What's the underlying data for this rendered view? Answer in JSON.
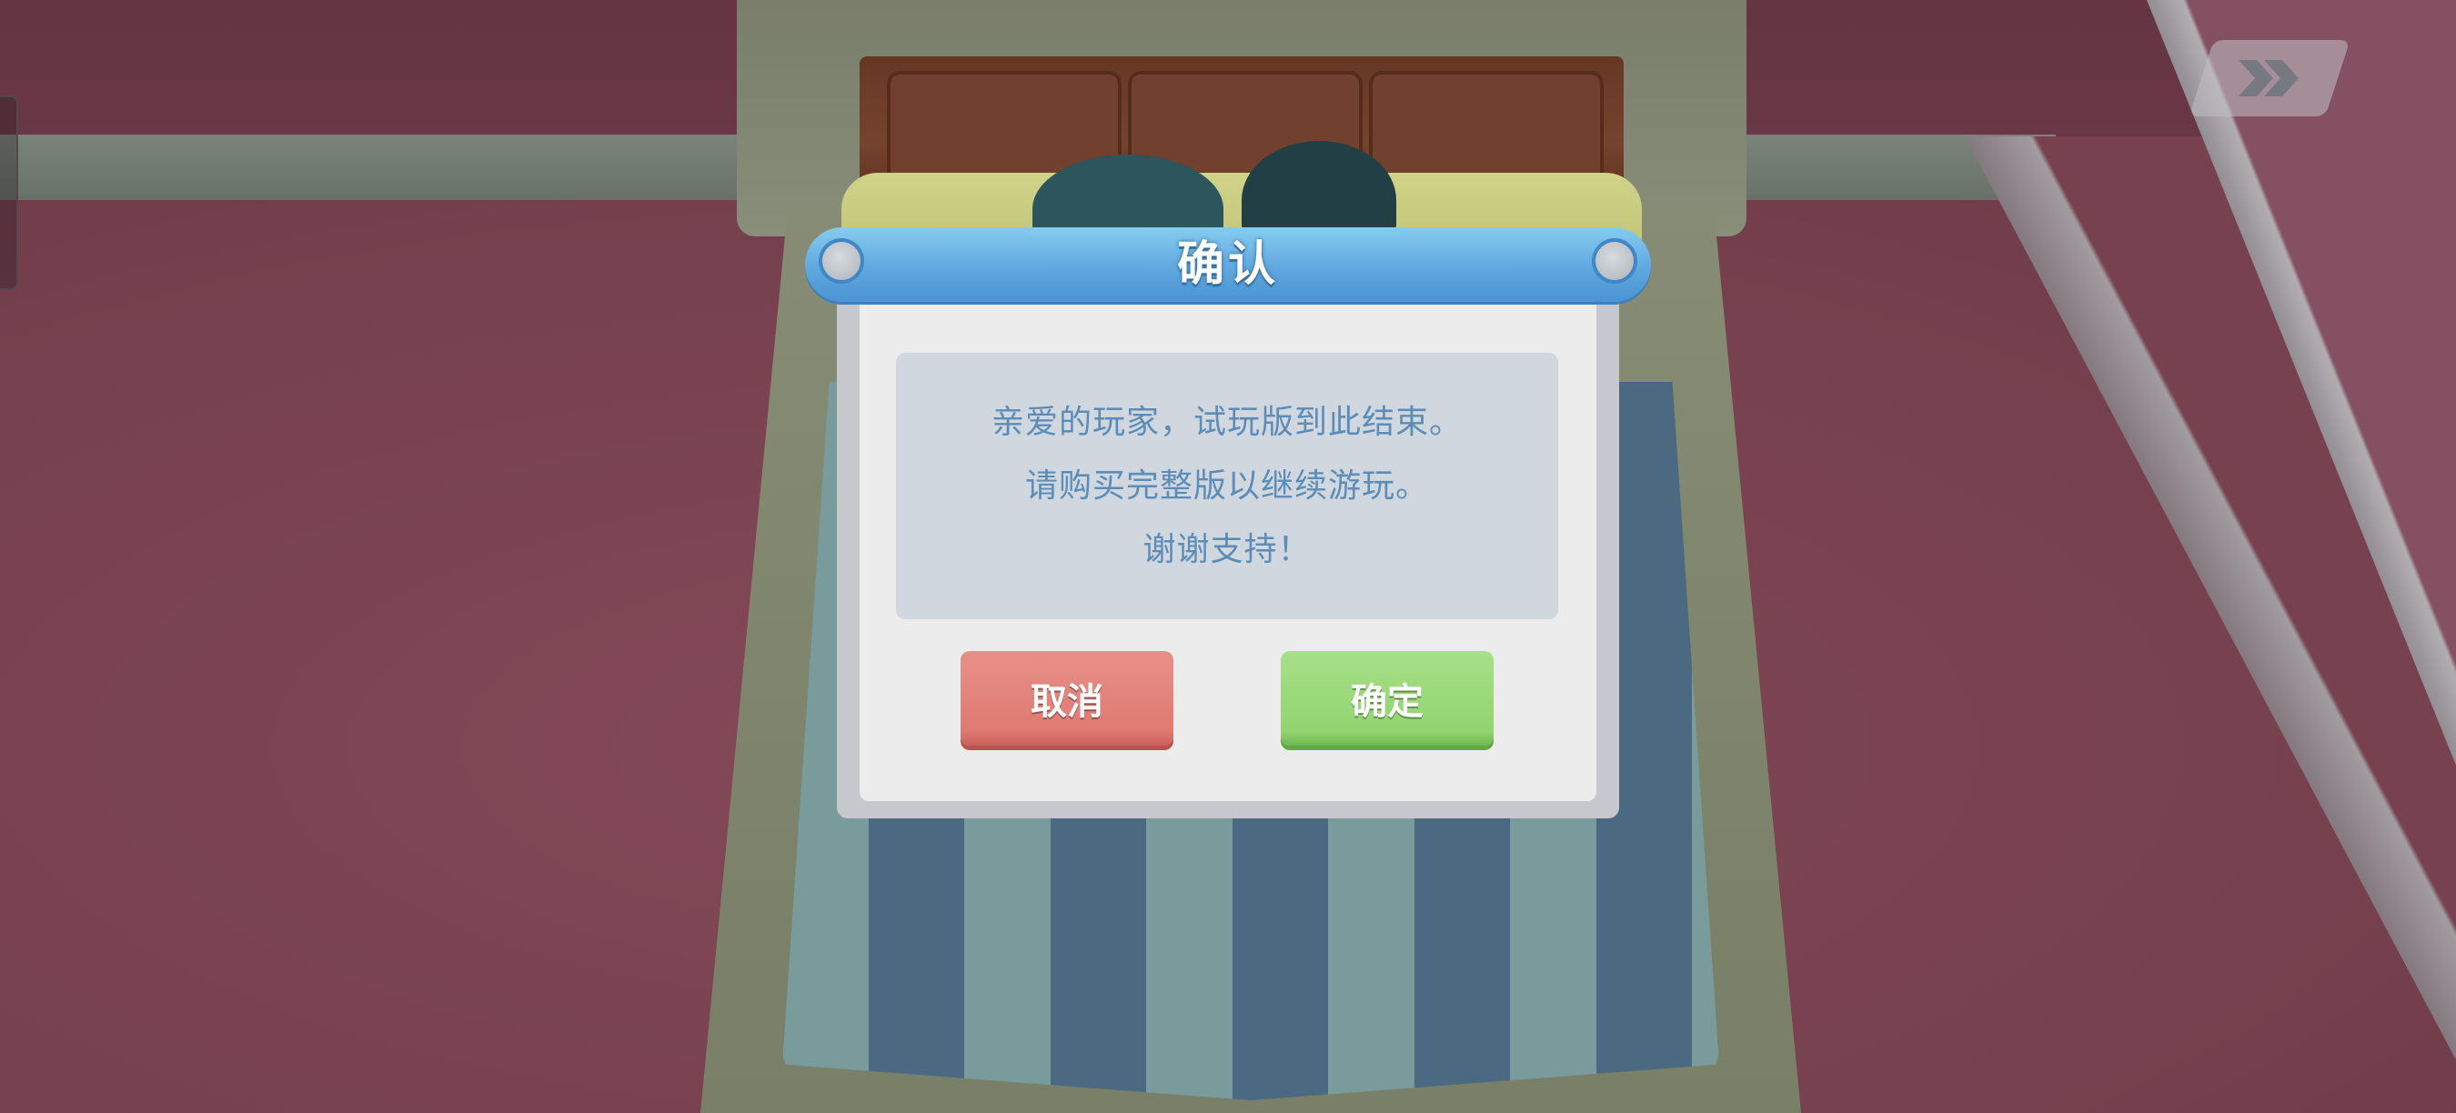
{
  "dialog": {
    "title": "确认",
    "message_lines": [
      "亲爱的玩家，试玩版到此结束。",
      "请购买完整版以继续游玩。",
      "谢谢支持！"
    ],
    "cancel_label": "取消",
    "confirm_label": "确定"
  },
  "hud": {
    "fast_forward_icon": "fast-forward-icon"
  },
  "colors": {
    "title_bar": "#5fa8e0",
    "message_text": "#5c8db8",
    "cancel_button": "#de7a72",
    "confirm_button": "#92d470"
  }
}
